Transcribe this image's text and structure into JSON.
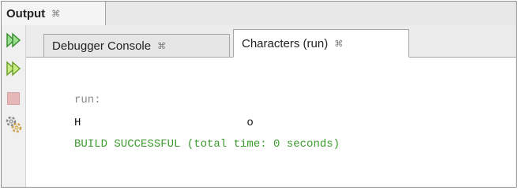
{
  "output_tab": {
    "label": "Output",
    "close_glyph": "⌘"
  },
  "tabs": [
    {
      "label": "Debugger Console",
      "close_glyph": "⌘",
      "active": false
    },
    {
      "label": "Characters (run)",
      "close_glyph": "⌘",
      "active": true
    }
  ],
  "toolbar": [
    {
      "icon": "rerun-icon"
    },
    {
      "icon": "rerun-with-options-icon"
    },
    {
      "icon": "stop-icon"
    },
    {
      "icon": "settings-icon"
    }
  ],
  "console": {
    "lines": [
      "run:",
      "H                         o",
      "BUILD SUCCESSFUL (total time: 0 seconds)"
    ]
  },
  "colors": {
    "run_line": "#8a8a8a",
    "output_line": "#111111",
    "success_line": "#3a9a2c",
    "rerun_icon": "#4caf50"
  }
}
